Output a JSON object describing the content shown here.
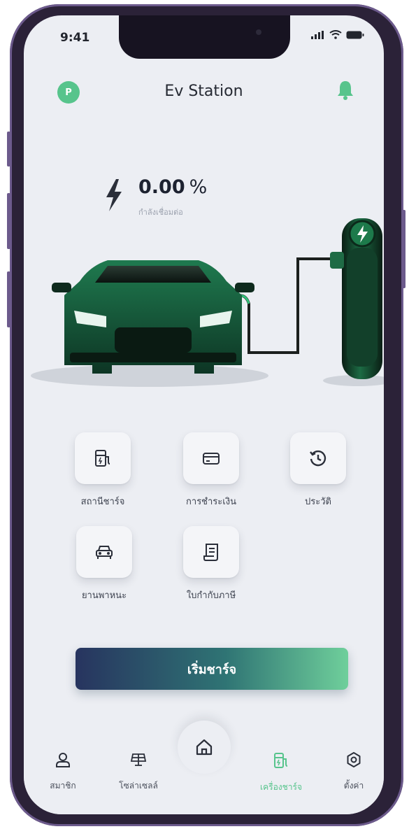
{
  "status_bar": {
    "time": "9:41"
  },
  "header": {
    "avatar_initial": "P",
    "title": "Ev Station"
  },
  "charge": {
    "value": "0.00",
    "unit": "%",
    "status": "กำลังเชื่อมต่อ"
  },
  "menu": [
    {
      "label": "สถานีชาร์จ",
      "icon": "charging-station-icon"
    },
    {
      "label": "การชำระเงิน",
      "icon": "credit-card-icon"
    },
    {
      "label": "ประวัติ",
      "icon": "history-icon"
    },
    {
      "label": "ยานพาหนะ",
      "icon": "car-icon"
    },
    {
      "label": "ใบกำกับภาษี",
      "icon": "receipt-icon"
    }
  ],
  "start_button": {
    "label": "เริ่มชาร์จ"
  },
  "bottom_nav": {
    "items": [
      {
        "label": "สมาชิก",
        "icon": "user-icon"
      },
      {
        "label": "โซล่าเซลล์",
        "icon": "solar-panel-icon"
      },
      {
        "label": "เครื่องชาร์จ",
        "icon": "charger-icon",
        "active": true
      },
      {
        "label": "ตั้งค่า",
        "icon": "settings-icon"
      }
    ],
    "home_icon": "home-icon"
  },
  "colors": {
    "accent": "#57c48c",
    "primary_dark": "#27345f",
    "background": "#eceef3"
  }
}
